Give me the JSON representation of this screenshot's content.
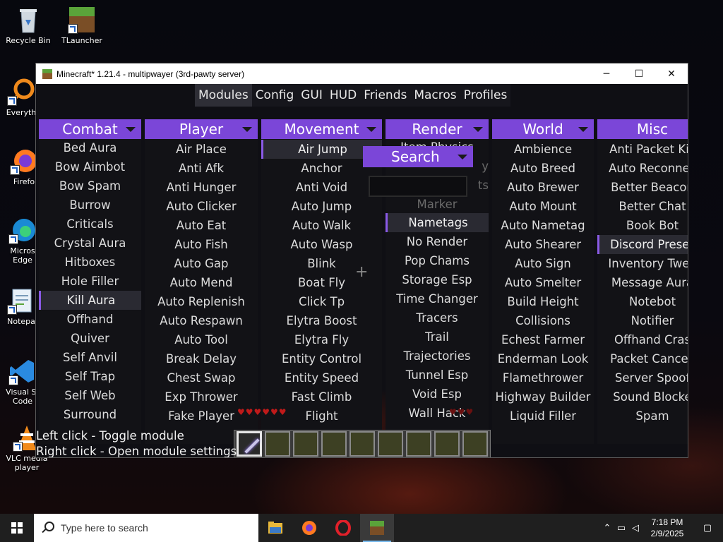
{
  "desktop": {
    "icons": [
      {
        "label": "Recycle Bin"
      },
      {
        "label": "TLauncher"
      },
      {
        "label": "Everyth"
      },
      {
        "label": "Firefo"
      },
      {
        "label": "Micros\nEdge"
      },
      {
        "label": "Notepa"
      },
      {
        "label": "Visual St\nCode"
      },
      {
        "label": "VLC media\nplayer"
      }
    ]
  },
  "window": {
    "title": "Minecraft* 1.21.4 - multipwayer (3rd-pawty server)",
    "minimize": "─",
    "maximize": "☐",
    "close": "✕"
  },
  "menu": {
    "tabs": [
      "Modules",
      "Config",
      "GUI",
      "HUD",
      "Friends",
      "Macros",
      "Profiles"
    ],
    "active": "Modules"
  },
  "columns": {
    "combat": {
      "title": "Combat",
      "modules": [
        "Bed Aura",
        "Bow Aimbot",
        "Bow Spam",
        "Burrow",
        "Criticals",
        "Crystal Aura",
        "Hitboxes",
        "Hole Filler",
        "Kill Aura",
        "Offhand",
        "Quiver",
        "Self Anvil",
        "Self Trap",
        "Self Web",
        "Surround"
      ]
    },
    "player": {
      "title": "Player",
      "modules": [
        "Air Place",
        "Anti Afk",
        "Anti Hunger",
        "Auto Clicker",
        "Auto Eat",
        "Auto Fish",
        "Auto Gap",
        "Auto Mend",
        "Auto Replenish",
        "Auto Respawn",
        "Auto Tool",
        "Break Delay",
        "Chest Swap",
        "Exp Thrower",
        "Fake Player"
      ]
    },
    "movement": {
      "title": "Movement",
      "modules": [
        "Air Jump",
        "Anchor",
        "Anti Void",
        "Auto Jump",
        "Auto Walk",
        "Auto Wasp",
        "Blink",
        "Boat Fly",
        "Click Tp",
        "Elytra Boost",
        "Elytra Fly",
        "Entity Control",
        "Entity Speed",
        "Fast Climb",
        "Flight"
      ]
    },
    "render": {
      "title": "Render",
      "modules_top": [
        "Item Physics",
        "y",
        "ts",
        "Marker"
      ],
      "modules": [
        "Nametags",
        "No Render",
        "Pop Chams",
        "Storage Esp",
        "Time Changer",
        "Tracers",
        "Trail",
        "Trajectories",
        "Tunnel Esp",
        "Void Esp",
        "Wall Hack"
      ]
    },
    "world": {
      "title": "World",
      "modules": [
        "Ambience",
        "Auto Breed",
        "Auto Brewer",
        "Auto Mount",
        "Auto Nametag",
        "Auto Shearer",
        "Auto Sign",
        "Auto Smelter",
        "Build Height",
        "Collisions",
        "Echest Farmer",
        "Enderman Look",
        "Flamethrower",
        "Highway Builder",
        "Liquid Filler"
      ]
    },
    "misc": {
      "title": "Misc",
      "modules": [
        "Anti Packet Kic",
        "Auto Reconnec",
        "Better Beacon",
        "Better Chat",
        "Book Bot",
        "Discord Presen",
        "Inventory Twea",
        "Message Aura",
        "Notebot",
        "Notifier",
        "Offhand Cras",
        "Packet Cancell",
        "Server Spoof",
        "Sound Blocke",
        "Spam"
      ]
    }
  },
  "search": {
    "title": "Search",
    "value": ""
  },
  "help": {
    "line1": "Left click - Toggle module",
    "line2": "Right click - Open module settings"
  },
  "taskbar": {
    "search_placeholder": "Type here to search",
    "time": "7:18 PM",
    "date": "2/9/2025"
  }
}
